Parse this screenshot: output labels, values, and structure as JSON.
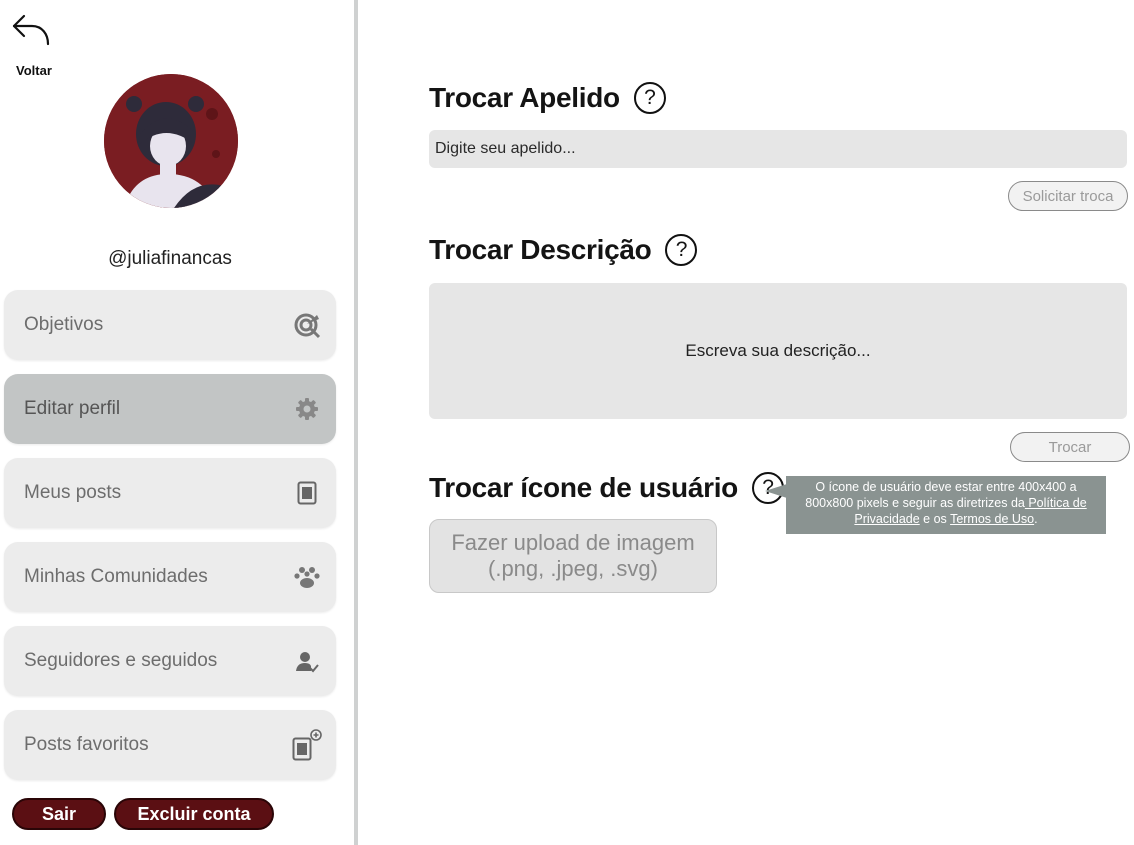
{
  "sidebar": {
    "back_label": "Voltar",
    "username": "@juliafinancas",
    "items": [
      {
        "label": "Objetivos",
        "icon": "target-icon"
      },
      {
        "label": "Editar perfil",
        "icon": "gear-icon",
        "active": true
      },
      {
        "label": "Meus posts",
        "icon": "document-icon"
      },
      {
        "label": "Minhas Comunidades",
        "icon": "paw-icon"
      },
      {
        "label": "Seguidores e seguidos",
        "icon": "user-check-icon"
      },
      {
        "label": "Posts favoritos",
        "icon": "document-plus-icon"
      }
    ],
    "logout_label": "Sair",
    "delete_account_label": "Excluir conta"
  },
  "nickname": {
    "title": "Trocar Apelido",
    "placeholder": "Digite seu apelido...",
    "submit_label": "Solicitar troca"
  },
  "description": {
    "title": "Trocar Descrição",
    "placeholder": "Escreva sua descrição...",
    "submit_label": "Trocar"
  },
  "user_icon": {
    "title": "Trocar ícone de usuário",
    "upload_line1": "Fazer upload de imagem",
    "upload_line2": "(.png, .jpeg, .svg)",
    "tooltip": {
      "text_before": "O ícone de usuário deve estar entre 400x400 a 800x800 pixels e seguir as diretrizes da",
      "privacy_link": " Política de Privacidade",
      "middle": " e os ",
      "terms_link": "Termos de Uso",
      "end": "."
    }
  },
  "help_glyph": "?",
  "colors": {
    "accent_dark": "#5b0f13",
    "active_item": "#c2c5c5",
    "field_bg": "#e6e6e6",
    "tooltip_bg": "#8a9391"
  }
}
